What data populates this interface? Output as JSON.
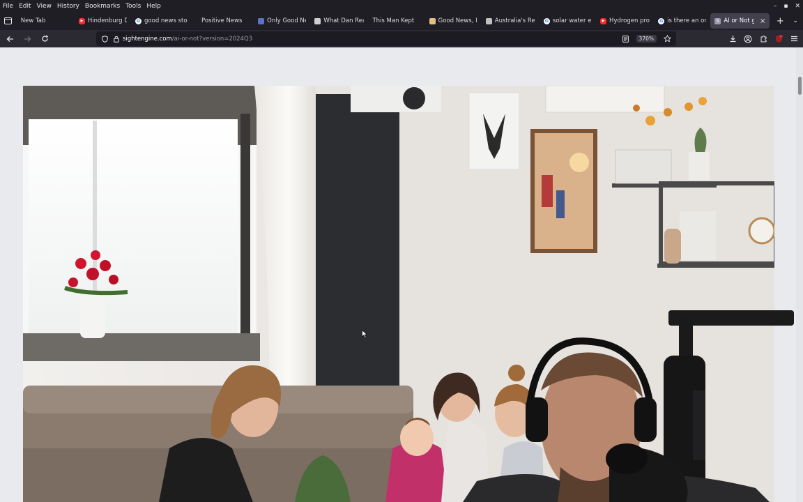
{
  "menubar": {
    "items": [
      {
        "label": "File",
        "key": "F"
      },
      {
        "label": "Edit",
        "key": "E"
      },
      {
        "label": "View",
        "key": "V"
      },
      {
        "label": "History",
        "key": "s"
      },
      {
        "label": "Bookmarks",
        "key": "B"
      },
      {
        "label": "Tools",
        "key": "T"
      },
      {
        "label": "Help",
        "key": "H"
      }
    ]
  },
  "tabs": [
    {
      "label": "New Tab",
      "favicon": "none",
      "color": ""
    },
    {
      "label": "Hindenburg D",
      "favicon": "youtube-icon",
      "color": "#ff2a2a"
    },
    {
      "label": "good news sto",
      "favicon": "google-icon",
      "color": "#ffffff"
    },
    {
      "label": "Positive News",
      "favicon": "none",
      "color": ""
    },
    {
      "label": "Only Good Nev",
      "favicon": "site-icon",
      "color": "#5a73c8"
    },
    {
      "label": "What Dan Read",
      "favicon": "page-icon",
      "color": "#d0d0d0"
    },
    {
      "label": "This Man Kept",
      "favicon": "none",
      "color": ""
    },
    {
      "label": "Good News, In",
      "favicon": "page-icon",
      "color": "#e0c080"
    },
    {
      "label": "Australia's Rev",
      "favicon": "page-icon",
      "color": "#c0c0c0"
    },
    {
      "label": "solar water ele",
      "favicon": "google-icon",
      "color": "#ffffff"
    },
    {
      "label": "Hydrogen proc",
      "favicon": "youtube-icon",
      "color": "#ff2a2a"
    },
    {
      "label": "is there an onli",
      "favicon": "google-icon",
      "color": "#ffffff"
    },
    {
      "label": "AI or Not ga",
      "favicon": "sightengine-icon",
      "color": "#9a9aa8",
      "active": true
    }
  ],
  "address": {
    "host": "sightengine.com",
    "path": "/ai-or-not?version=2024Q3",
    "zoom": "370%"
  },
  "window_controls": {
    "minimize": "–",
    "maximize": "▪",
    "close": "✕"
  },
  "colors": {
    "chrome_dark": "#1f1e25",
    "navbar": "#2b2a33",
    "urlbar": "#1c1b22",
    "page_bg": "#e9eaee",
    "accent_red": "#ff2a2a"
  },
  "icons": {
    "tab_list": "tab-list-icon",
    "back": "back-arrow-icon",
    "forward": "forward-arrow-icon",
    "reload": "reload-icon",
    "shield": "shield-icon",
    "lock": "lock-icon",
    "reader": "reader-view-icon",
    "bookmark": "star-icon",
    "downloads": "download-icon",
    "account": "account-icon",
    "extensions": "puzzle-icon",
    "ublock": "ublock-icon",
    "menu": "hamburger-menu-icon"
  }
}
